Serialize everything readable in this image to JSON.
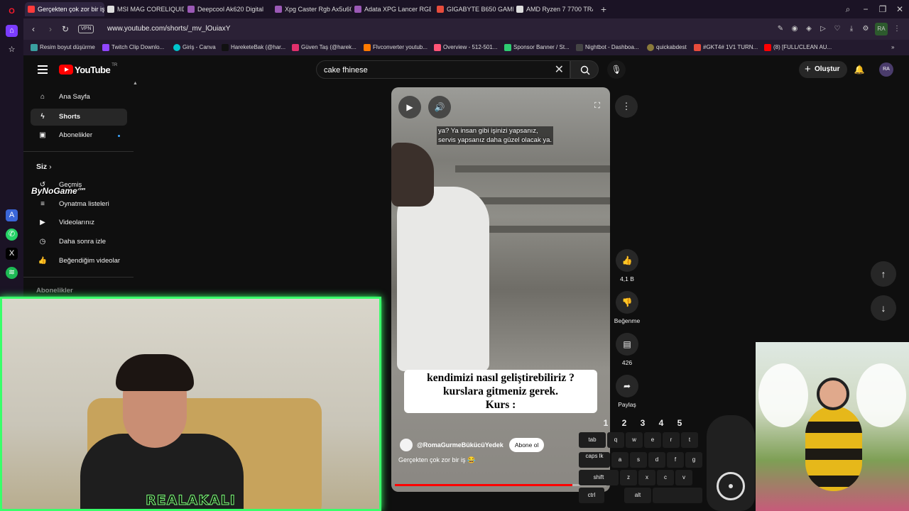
{
  "browser": {
    "tabs": [
      {
        "label": "Gerçekten çok zor bir iş 😂",
        "active": true,
        "color": "#ff3b3b"
      },
      {
        "label": "MSI MAG CORELIQUID 24",
        "active": false,
        "color": "#dddddd"
      },
      {
        "label": "Deepcool Ak620 Digital P",
        "active": false,
        "color": "#9b59b6"
      },
      {
        "label": "Xpg Caster Rgb Ax5u600C",
        "active": false,
        "color": "#9b59b6"
      },
      {
        "label": "Adata XPG Lancer RGB AX",
        "active": false,
        "color": "#9b59b6"
      },
      {
        "label": "GIGABYTE B650 GAMING",
        "active": false,
        "color": "#e74c3c"
      },
      {
        "label": "AMD Ryzen 7 7700 TRAY",
        "active": false,
        "color": "#dddddd"
      }
    ],
    "new_tab": "+",
    "vpn_label": "VPN",
    "url": "www.youtube.com/shorts/_mv_lOuiaxY",
    "profile_badge": "RA",
    "bookmarks": [
      {
        "label": "Resim boyut düşürme",
        "color": "#3aa0a0"
      },
      {
        "label": "Twitch Clip Downlo...",
        "color": "#9146ff"
      },
      {
        "label": "Giriş - Canva",
        "color": "#00c4cc"
      },
      {
        "label": "HareketeBak (@har...",
        "color": "#111111"
      },
      {
        "label": "Güven Taş (@harek...",
        "color": "#e1306c"
      },
      {
        "label": "Flvconverter youtub...",
        "color": "#ff7a00"
      },
      {
        "label": "Overview - 512-501...",
        "color": "#ff5577"
      },
      {
        "label": "Sponsor Banner / St...",
        "color": "#2ecc71"
      },
      {
        "label": "Nightbot - Dashboa...",
        "color": "#444444"
      },
      {
        "label": "quickabdest",
        "color": "#8a7a3a"
      },
      {
        "label": "#GKT4# 1V1 TURN...",
        "color": "#e74c3c"
      },
      {
        "label": "(8) [FULL/CLEAN AU...",
        "color": "#ff0000"
      }
    ]
  },
  "youtube": {
    "logo": "YouTube",
    "region": "TR",
    "search": {
      "value": "cake fhinese",
      "placeholder": "Ara"
    },
    "create_label": "Oluştur",
    "avatar_initials": "RA",
    "guide": {
      "home": "Ana Sayfa",
      "shorts": "Shorts",
      "subscriptions": "Abonelikler",
      "you_heading": "Siz",
      "history": "Geçmiş",
      "playlists": "Oynatma listeleri",
      "your_videos": "Videolarınız",
      "watch_later": "Daha sonra izle",
      "liked": "Beğendiğim videolar",
      "subscriptions_heading": "Abonelikler"
    },
    "short": {
      "subtitle_line1": "ya? Ya insan gibi işinizi yapsanız,",
      "subtitle_line2": "servis yapsanız daha güzel olacak ya.",
      "caption_line1": "kendimizi nasıl geliştirebiliriz ?",
      "caption_line2": "kurslara gitmeniz gerek.",
      "caption_line3": "Kurs :",
      "channel": "@RomaGurmeBükücüYedek",
      "subscribe_label": "Abone ol",
      "title": "Gerçekten çok zor bir iş 😂",
      "progress": 0.84
    },
    "actions": {
      "like_count": "4,1 B",
      "dislike_label": "Beğenme",
      "comment_count": "426",
      "share_label": "Paylaş"
    }
  },
  "overlays": {
    "watermark_main": "ByNoGame",
    "watermark_sup": ".com",
    "streamer_name": "REALAKALI",
    "keyboard_numbers": [
      "1",
      "2",
      "3",
      "4",
      "5"
    ],
    "keyboard_row1": [
      "tab",
      "q",
      "w",
      "e",
      "r",
      "t"
    ],
    "keyboard_row2": [
      "caps lk",
      "a",
      "s",
      "d",
      "f",
      "g"
    ],
    "keyboard_row3": [
      "shift",
      "z",
      "x",
      "c",
      "v"
    ],
    "keyboard_row4": [
      "ctrl",
      "alt"
    ]
  },
  "colors": {
    "webcam_border": "#39ff6a",
    "youtube_red": "#ff0000"
  }
}
